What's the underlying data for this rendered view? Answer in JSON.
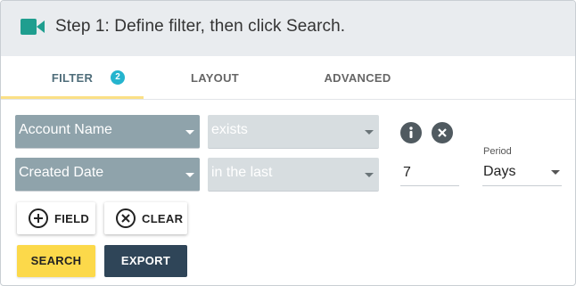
{
  "header": {
    "title": "Step 1: Define filter, then click Search.",
    "icon": "video-camera-icon",
    "icon_color": "#1f9e8f"
  },
  "tabs": [
    {
      "label": "FILTER",
      "badge": "2",
      "active": true
    },
    {
      "label": "LAYOUT",
      "active": false
    },
    {
      "label": "ADVANCED",
      "active": false
    }
  ],
  "filters": [
    {
      "field": "Account Name",
      "operator": "exists",
      "value": ""
    },
    {
      "field": "Created Date",
      "operator": "in the last",
      "value": "7"
    }
  ],
  "period": {
    "label": "Period",
    "value": "Days"
  },
  "buttons": {
    "field": "FIELD",
    "clear": "CLEAR",
    "search": "SEARCH",
    "export": "EXPORT"
  },
  "colors": {
    "accent_yellow": "#fcd94a",
    "export_bg": "#2f4558",
    "badge": "#25b4ce"
  }
}
